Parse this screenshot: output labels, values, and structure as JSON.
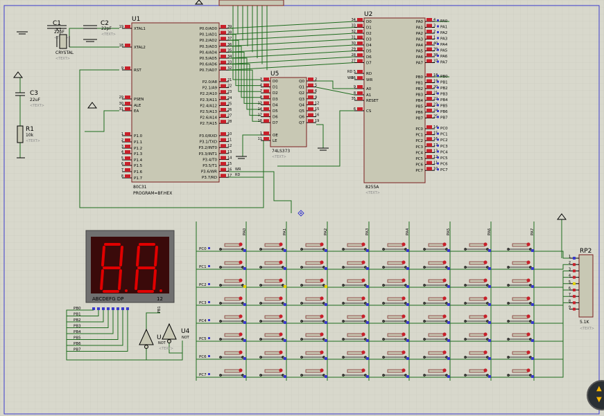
{
  "colors": {
    "bg": "#d8d8cc",
    "grid": "#c9c9bd",
    "chip": "#c8c8b4",
    "wire": "#1d6b1d",
    "red": "#c8202a",
    "text": "#000000",
    "ghost": "#8a8a8a",
    "led_on": "#e00000",
    "led_bezel": "#707070",
    "led_body": "#3a0a0a"
  },
  "parts": {
    "c1": {
      "ref": "C1",
      "val": "22pF",
      "text": "<TEXT>"
    },
    "c2": {
      "ref": "C2",
      "val": "22pF",
      "text": "<TEXT>"
    },
    "x1": {
      "ref": "X1",
      "val": "CRYSTAL",
      "text": "<TEXT>"
    },
    "c3": {
      "ref": "C3",
      "val": "22uF",
      "text": "<TEXT>"
    },
    "r1": {
      "ref": "R1",
      "val": "10k",
      "text": "<TEXT>"
    },
    "u1": {
      "ref": "U1",
      "val": "80C31",
      "prog": "PROGRAM=BF.HEX",
      "text": "<TEXT>"
    },
    "u2": {
      "ref": "U2",
      "val": "8255A",
      "text": "<TEXT>"
    },
    "u5": {
      "ref": "U5",
      "val": "74LS373",
      "text": "<TEXT>"
    },
    "u4": {
      "ref": "U4",
      "val": "NOT",
      "text": "<TEXT>"
    },
    "u3": {
      "ref": "U",
      "val": "NOT"
    },
    "rp2": {
      "ref": "RP2",
      "val": "5.1K",
      "text": "<TEXT>"
    },
    "disp": {
      "label": "ABCDEFG DP",
      "label2": "12"
    }
  },
  "u1_left": [
    {
      "n": "19",
      "l": "XTAL1"
    },
    {
      "n": "18",
      "l": "XTAL2"
    },
    {
      "n": "9",
      "l": "RST"
    },
    {
      "n": "29",
      "l": "PSEN"
    },
    {
      "n": "30",
      "l": "ALE"
    },
    {
      "n": "31",
      "l": "EA"
    },
    {
      "n": "1",
      "l": "P1.0"
    },
    {
      "n": "2",
      "l": "P1.1"
    },
    {
      "n": "3",
      "l": "P1.2"
    },
    {
      "n": "4",
      "l": "P1.3"
    },
    {
      "n": "5",
      "l": "P1.4"
    },
    {
      "n": "6",
      "l": "P1.5"
    },
    {
      "n": "7",
      "l": "P1.6"
    },
    {
      "n": "8",
      "l": "P1.7"
    }
  ],
  "u1_right": [
    {
      "n": "39",
      "l": "P0.0/AD0"
    },
    {
      "n": "38",
      "l": "P0.1/AD1"
    },
    {
      "n": "37",
      "l": "P0.2/AD2"
    },
    {
      "n": "36",
      "l": "P0.3/AD3"
    },
    {
      "n": "35",
      "l": "P0.4/AD4"
    },
    {
      "n": "34",
      "l": "P0.5/AD5"
    },
    {
      "n": "33",
      "l": "P0.6/AD6"
    },
    {
      "n": "32",
      "l": "P0.7/AD7"
    },
    {
      "n": "21",
      "l": "P2.0/A8"
    },
    {
      "n": "22",
      "l": "P2.1/A9"
    },
    {
      "n": "23",
      "l": "P2.2/A10"
    },
    {
      "n": "24",
      "l": "P2.3/A11"
    },
    {
      "n": "25",
      "l": "P2.4/A12"
    },
    {
      "n": "26",
      "l": "P2.5/A13"
    },
    {
      "n": "27",
      "l": "P2.6/A14"
    },
    {
      "n": "28",
      "l": "P2.7/A15"
    },
    {
      "n": "10",
      "l": "P3.0/RXD"
    },
    {
      "n": "11",
      "l": "P3.1/TXD"
    },
    {
      "n": "12",
      "l": "P3.2/INT0"
    },
    {
      "n": "13",
      "l": "P3.3/INT1"
    },
    {
      "n": "14",
      "l": "P3.4/T0"
    },
    {
      "n": "15",
      "l": "P3.5/T1"
    },
    {
      "n": "16",
      "l": "P3.6/WR"
    },
    {
      "n": "17",
      "l": "P3.7/RD"
    }
  ],
  "u1_nets": {
    "wr": "WR",
    "rd": "RD"
  },
  "u2_left": [
    {
      "n": "34",
      "l": "D0"
    },
    {
      "n": "33",
      "l": "D1"
    },
    {
      "n": "32",
      "l": "D2"
    },
    {
      "n": "31",
      "l": "D3"
    },
    {
      "n": "30",
      "l": "D4"
    },
    {
      "n": "29",
      "l": "D5"
    },
    {
      "n": "28",
      "l": "D6"
    },
    {
      "n": "27",
      "l": "D7"
    },
    {
      "n": "5",
      "l": "RD",
      "net": "RD"
    },
    {
      "n": "36",
      "l": "WR",
      "net": "WR"
    },
    {
      "n": "9",
      "l": "A0"
    },
    {
      "n": "8",
      "l": "A1"
    },
    {
      "n": "35",
      "l": "RESET"
    },
    {
      "n": "6",
      "l": "CS"
    }
  ],
  "u2_right": [
    {
      "n": "4",
      "l": "PA0",
      "net": "PA0"
    },
    {
      "n": "3",
      "l": "PA1",
      "net": "PA1"
    },
    {
      "n": "2",
      "l": "PA2",
      "net": "PA2"
    },
    {
      "n": "1",
      "l": "PA3",
      "net": "PA3"
    },
    {
      "n": "40",
      "l": "PA4",
      "net": "PA4"
    },
    {
      "n": "39",
      "l": "PA5",
      "net": "PA5"
    },
    {
      "n": "38",
      "l": "PA6",
      "net": "PA6"
    },
    {
      "n": "37",
      "l": "PA7",
      "net": "PA7"
    },
    {
      "n": "18",
      "l": "PB0",
      "net": "PB0"
    },
    {
      "n": "19",
      "l": "PB1",
      "net": "PB1"
    },
    {
      "n": "20",
      "l": "PB2",
      "net": "PB2"
    },
    {
      "n": "21",
      "l": "PB3",
      "net": "PB3"
    },
    {
      "n": "22",
      "l": "PB4",
      "net": "PB4"
    },
    {
      "n": "23",
      "l": "PB5",
      "net": "PB5"
    },
    {
      "n": "24",
      "l": "PB6",
      "net": "PB6"
    },
    {
      "n": "25",
      "l": "PB7",
      "net": "PB7"
    },
    {
      "n": "14",
      "l": "PC0",
      "net": "PC0"
    },
    {
      "n": "15",
      "l": "PC1",
      "net": "PC1"
    },
    {
      "n": "16",
      "l": "PC2",
      "net": "PC2"
    },
    {
      "n": "17",
      "l": "PC3",
      "net": "PC3"
    },
    {
      "n": "13",
      "l": "PC4",
      "net": "PC4"
    },
    {
      "n": "12",
      "l": "PC5",
      "net": "PC5"
    },
    {
      "n": "11",
      "l": "PC6",
      "net": "PC6"
    },
    {
      "n": "10",
      "l": "PC7",
      "net": "PC7"
    }
  ],
  "u5_left": [
    {
      "n": "3",
      "l": "D0"
    },
    {
      "n": "4",
      "l": "D1"
    },
    {
      "n": "7",
      "l": "D2"
    },
    {
      "n": "8",
      "l": "D3"
    },
    {
      "n": "13",
      "l": "D4"
    },
    {
      "n": "14",
      "l": "D5"
    },
    {
      "n": "17",
      "l": "D6"
    },
    {
      "n": "18",
      "l": "D7"
    },
    {
      "n": "1",
      "l": "OE"
    },
    {
      "n": "11",
      "l": "LE"
    }
  ],
  "u5_right": [
    {
      "n": "2",
      "l": "Q0"
    },
    {
      "n": "5",
      "l": "Q1"
    },
    {
      "n": "6",
      "l": "Q2"
    },
    {
      "n": "9",
      "l": "Q3"
    },
    {
      "n": "12",
      "l": "Q4"
    },
    {
      "n": "15",
      "l": "Q5"
    },
    {
      "n": "16",
      "l": "Q6"
    },
    {
      "n": "19",
      "l": "Q7"
    }
  ],
  "rp2_pins": [
    "1",
    "2",
    "3",
    "4",
    "5",
    "6",
    "7",
    "8",
    "9"
  ],
  "keypad": {
    "cols": [
      "PA0",
      "PA1",
      "PA2",
      "PA3",
      "PA4",
      "PA5",
      "PA6",
      "PA7"
    ],
    "rows": [
      "PC0",
      "PC1",
      "PC2",
      "PC3",
      "PC4",
      "PC5",
      "PC6",
      "PC7"
    ]
  },
  "seg_nets": [
    "PB0",
    "PB1",
    "PB2",
    "PB3",
    "PB4",
    "PB5",
    "PB6",
    "PB7"
  ],
  "disp_nets": [
    "PB1"
  ],
  "nav": {
    "up": "▲",
    "down": "▼"
  }
}
